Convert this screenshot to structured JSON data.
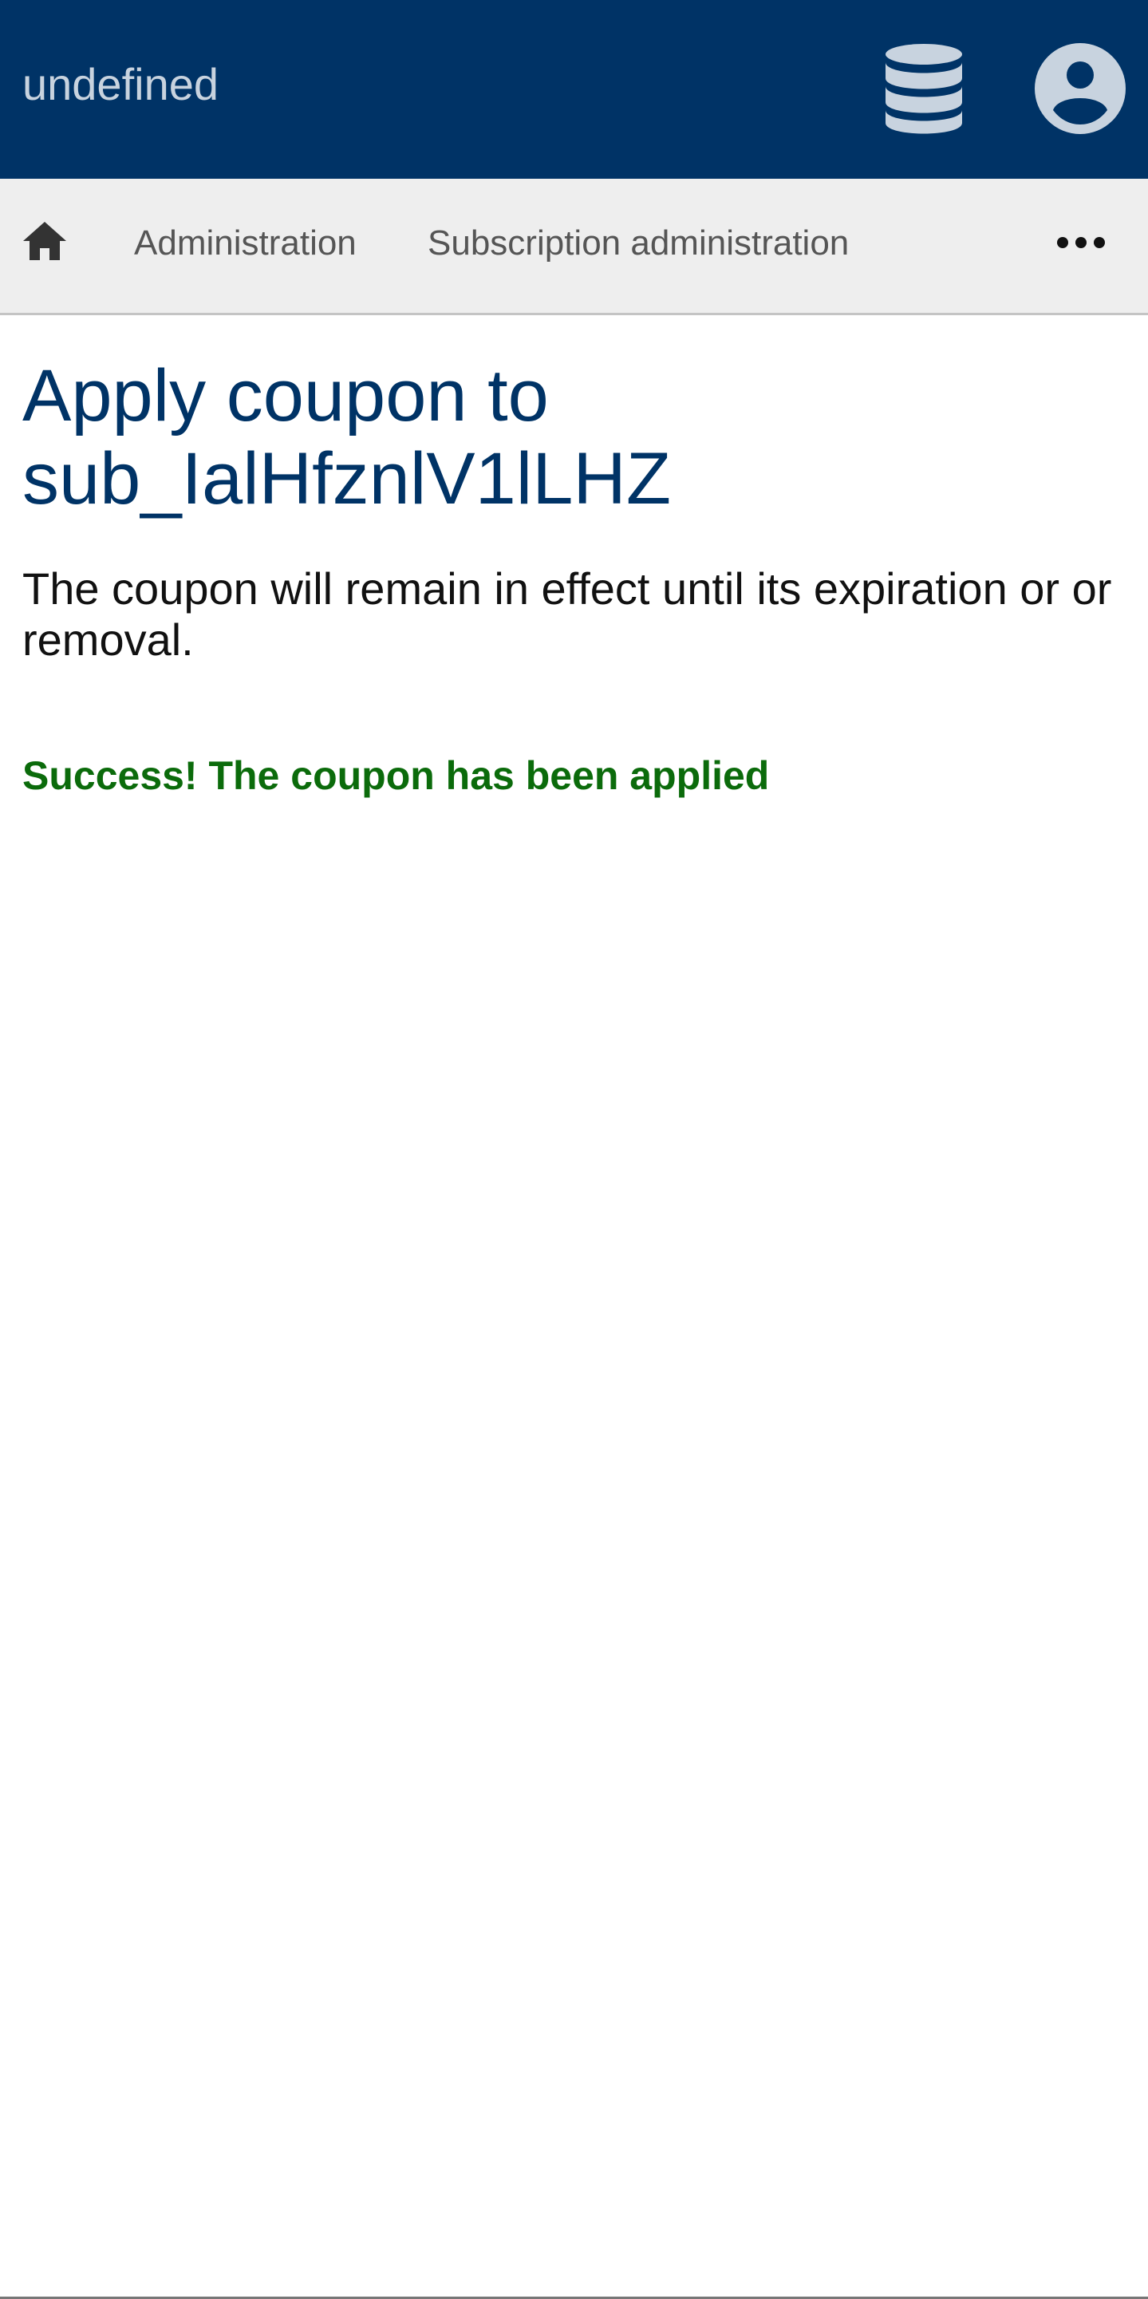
{
  "header": {
    "app_title": "undefined",
    "database_icon": "database-icon",
    "account_icon": "user-circle-icon",
    "background_color": "#003366"
  },
  "nav": {
    "home_icon": "home-icon",
    "items": [
      {
        "label": "Administration"
      },
      {
        "label": "Subscription administration"
      }
    ],
    "more_icon": "more-horizontal-icon"
  },
  "main": {
    "title": "Apply coupon to sub_IalHfznlV1lLHZ",
    "description": "The coupon will remain in effect until its expiration or or removal.",
    "success_message": "Success! The coupon has been applied",
    "success_color": "#0b6b0b",
    "title_color": "#003366"
  }
}
